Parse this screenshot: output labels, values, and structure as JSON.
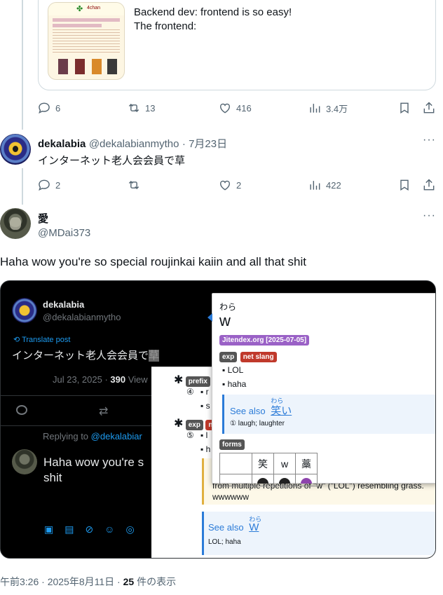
{
  "quote": {
    "text_line1": "Backend dev: frontend is so easy!",
    "text_line2": "The frontend:",
    "thumb_logo": "4chan"
  },
  "tweet1_actions": {
    "replies": "6",
    "reposts": "13",
    "likes": "416",
    "views": "3.4万"
  },
  "reply1": {
    "name": "dekalabia",
    "handle": "@dekalabianmytho",
    "date": "· 7月23日",
    "text": "インターネット老人会会員で草",
    "replies": "2",
    "likes": "2",
    "views": "422"
  },
  "reply2": {
    "name": "愛",
    "handle": "@MDai373",
    "text": "Haha wow you're so special roujinkai kaiin and all that shit"
  },
  "screenshot": {
    "name": "dekalabia",
    "handle": "@dekalabianmytho",
    "translate": "Translate post",
    "tweet_text": "インターネット老人会会員で",
    "date": "Jul 23, 2025 · ",
    "views_num": "390",
    "views_label": " View",
    "replying_prefix": "Replying to ",
    "replying_handle": "@dekalabiar",
    "reply_line1": "Haha wow you're s",
    "reply_line2": "shit",
    "popup": {
      "reading": "わら",
      "term": "w",
      "source": "Jitendex.org [2025-07-05]",
      "tag_exp": "exp",
      "tag_slang": "net slang",
      "glosses": [
        "LOL",
        "haha"
      ],
      "see_also_label": "See also",
      "see_also_ruby": "わら",
      "see_also_word": "笑い",
      "see_also_gloss": "① laugh; laughter",
      "forms_label": "forms",
      "forms": [
        "笑",
        "w",
        "藁"
      ]
    },
    "popup2": {
      "tag_prefix": "prefix",
      "num4": "④",
      "num5": "⑤",
      "tag_exp": "exp",
      "tag_ne": "ne",
      "bullet_r": "r",
      "bullet_s": "s",
      "bullet_l": "l",
      "bullet_h": "h",
      "note_line": "from multiple repetitions of \"w\" (\"LOL\") resembling grass.",
      "note_www": "wwwwww",
      "see_also_label": "See also",
      "see_also_ruby": "わら",
      "see_also_word": "W",
      "see_also_gloss": "LOL; haha"
    }
  },
  "footer": {
    "time": "午前3:26 · 2025年8月11日 · ",
    "views_num": "25",
    "views_label": " 件の表示"
  }
}
